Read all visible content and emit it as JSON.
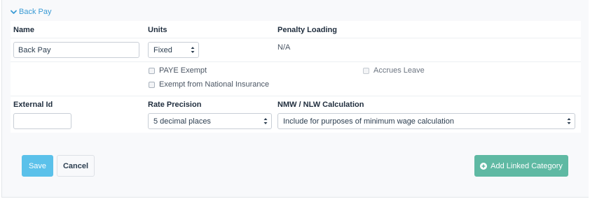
{
  "section": {
    "title": "Back Pay"
  },
  "fields": {
    "name_label": "Name",
    "name_value": "Back Pay",
    "units_label": "Units",
    "units_value": "Fixed",
    "penalty_label": "Penalty Loading",
    "penalty_value": "N/A",
    "paye_exempt_label": "PAYE Exempt",
    "paye_exempt_checked": false,
    "accrues_leave_label": "Accrues Leave",
    "accrues_leave_checked": false,
    "ni_exempt_label": "Exempt from National Insurance",
    "ni_exempt_checked": false,
    "external_id_label": "External Id",
    "external_id_value": "",
    "rate_precision_label": "Rate Precision",
    "rate_precision_value": "5 decimal places",
    "nmw_label": "NMW / NLW Calculation",
    "nmw_value": "Include for purposes of minimum wage calculation"
  },
  "actions": {
    "save_label": "Save",
    "cancel_label": "Cancel",
    "add_linked_label": "Add Linked Category"
  },
  "colors": {
    "link": "#3a9bd5",
    "save": "#5bc1ea",
    "add_linked": "#5fb9a3"
  },
  "icons": {
    "toggle": "chevron-down-icon",
    "add": "plus-circle-icon",
    "select": "select-arrows-icon"
  }
}
